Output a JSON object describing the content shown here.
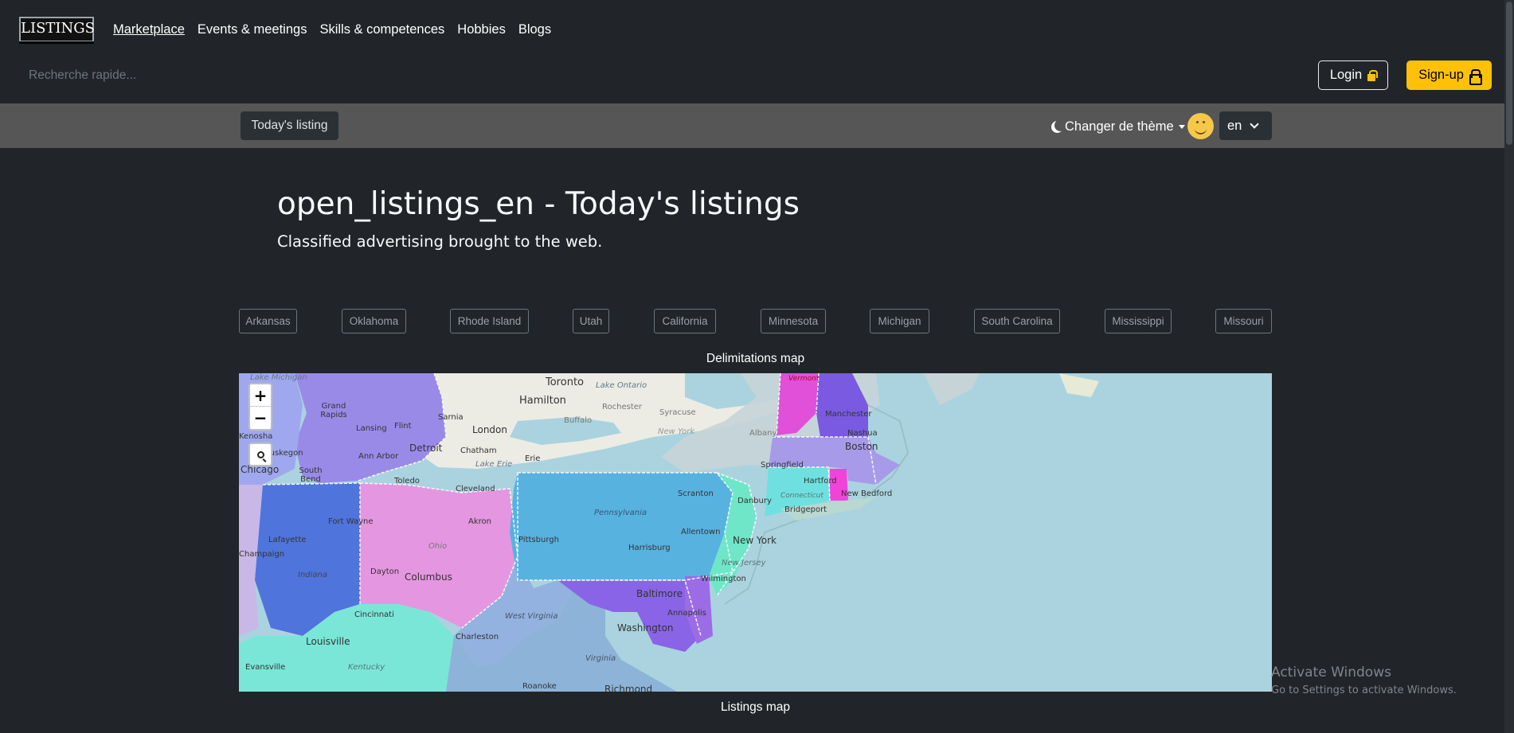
{
  "nav": {
    "logo": "LISTINGS",
    "links": [
      "Marketplace",
      "Events & meetings",
      "Skills & competences",
      "Hobbies",
      "Blogs"
    ],
    "search_placeholder": "Recherche rapide...",
    "login_label": "Login",
    "signup_label": "Sign-up"
  },
  "subbar": {
    "today_label": "Today's listing",
    "theme_label": "Changer de thème",
    "lang_value": "en"
  },
  "header": {
    "title": "open_listings_en - Today's listings",
    "subtitle": "Classified advertising brought to the web."
  },
  "states": [
    "Arkansas",
    "Oklahoma",
    "Rhode Island",
    "Utah",
    "California",
    "Minnesota",
    "Michigan",
    "South Carolina",
    "Mississippi",
    "Missouri"
  ],
  "map": {
    "caption_top": "Delimitations map",
    "caption_bottom": "Listings map",
    "zoom_in": "+",
    "zoom_out": "−",
    "labels": {
      "toronto": "Toronto",
      "hamilton": "Hamilton",
      "london": "London",
      "chatham": "Chatham",
      "detroit": "Detroit",
      "grand_rapids": "Grand Rapids",
      "lansing": "Lansing",
      "flint": "Flint",
      "ann_arbor": "Ann Arbor",
      "toledo": "Toledo",
      "cleveland": "Cleveland",
      "akron": "Akron",
      "columbus": "Columbus",
      "dayton": "Dayton",
      "ohio": "Ohio",
      "fort_wayne": "Fort Wayne",
      "lafayette": "Lafayette",
      "indiana": "Indiana",
      "louisville": "Louisville",
      "kentucky": "Kentucky",
      "cincinnati": "Cincinnati",
      "pittsburgh": "Pittsburgh",
      "pennsylvania": "Pennsylvania",
      "harrisburg": "Harrisburg",
      "scranton": "Scranton",
      "allentown": "Allentown",
      "new_york": "New York",
      "new_jersey": "New Jersey",
      "wilmington": "Wilmington",
      "baltimore": "Baltimore",
      "annapolis": "Annapolis",
      "washington": "Washington",
      "west_virginia": "West Virginia",
      "virginia": "Virginia",
      "charleston": "Charleston",
      "richmond": "Richmond",
      "roanoke": "Roanoke",
      "rochester": "Rochester",
      "syracuse": "Syracuse",
      "buffalo": "Buffalo",
      "albany": "Albany",
      "new_york_state": "New York",
      "hartford": "Hartford",
      "connecticut": "Connecticut",
      "bridgeport": "Bridgeport",
      "danbury": "Danbury",
      "springfield": "Springfield",
      "boston": "Boston",
      "manchester": "Manchester",
      "nashua": "Nashua",
      "new_bedford": "New Bedford",
      "vermont": "Vermont",
      "lake_ontario": "Lake Ontario",
      "lake_erie": "Lake Erie",
      "lake_michigan": "Lake Michigan",
      "sarnia": "Sarnia",
      "erie": "Erie",
      "south_bend": "South Bend",
      "muskegon": "Muskegon",
      "kenosha": "Kenosha",
      "chicago": "Chicago",
      "champaign": "Champaign",
      "evansville": "Evansville"
    }
  },
  "os_notice": {
    "title": "Activate Windows",
    "subtitle": "Go to Settings to activate Windows."
  },
  "colors": {
    "background": "#212529",
    "subbar": "#565656",
    "accent": "#ffc107",
    "water": "#aad3df"
  }
}
